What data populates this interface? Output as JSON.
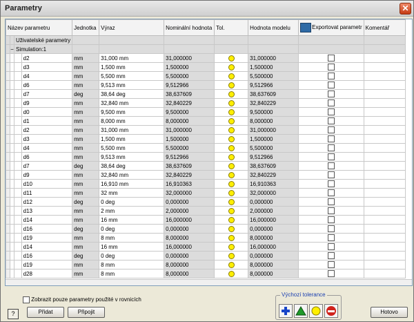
{
  "window": {
    "title": "Parametry"
  },
  "columns": [
    "Název parametru",
    "Jednotka",
    "Výraz",
    "Nominální hodnota",
    "Tol.",
    "Hodnota modelu",
    "Exportovat parametr",
    "Komentář"
  ],
  "groups": {
    "user": "Uživatelské parametry",
    "sim": "Simulation:1",
    "sim_toggle": "−"
  },
  "rows": [
    {
      "name": "d2",
      "unit": "mm",
      "expr": "31,000 mm",
      "nominal": "31,000000",
      "model": "31,000000"
    },
    {
      "name": "d3",
      "unit": "mm",
      "expr": "1,500 mm",
      "nominal": "1,500000",
      "model": "1,500000"
    },
    {
      "name": "d4",
      "unit": "mm",
      "expr": "5,500 mm",
      "nominal": "5,500000",
      "model": "5,500000"
    },
    {
      "name": "d6",
      "unit": "mm",
      "expr": "9,513 mm",
      "nominal": "9,512966",
      "model": "9,512966"
    },
    {
      "name": "d7",
      "unit": "deg",
      "expr": "38,64 deg",
      "nominal": "38,637609",
      "model": "38,637609"
    },
    {
      "name": "d9",
      "unit": "mm",
      "expr": "32,840 mm",
      "nominal": "32,840229",
      "model": "32,840229"
    },
    {
      "name": "d0",
      "unit": "mm",
      "expr": "9,500 mm",
      "nominal": "9,500000",
      "model": "9,500000"
    },
    {
      "name": "d1",
      "unit": "mm",
      "expr": "8,000 mm",
      "nominal": "8,000000",
      "model": "8,000000"
    },
    {
      "name": "d2",
      "unit": "mm",
      "expr": "31,000 mm",
      "nominal": "31,000000",
      "model": "31,000000"
    },
    {
      "name": "d3",
      "unit": "mm",
      "expr": "1,500 mm",
      "nominal": "1,500000",
      "model": "1,500000"
    },
    {
      "name": "d4",
      "unit": "mm",
      "expr": "5,500 mm",
      "nominal": "5,500000",
      "model": "5,500000"
    },
    {
      "name": "d6",
      "unit": "mm",
      "expr": "9,513 mm",
      "nominal": "9,512966",
      "model": "9,512966"
    },
    {
      "name": "d7",
      "unit": "deg",
      "expr": "38,64 deg",
      "nominal": "38,637609",
      "model": "38,637609"
    },
    {
      "name": "d9",
      "unit": "mm",
      "expr": "32,840 mm",
      "nominal": "32,840229",
      "model": "32,840229"
    },
    {
      "name": "d10",
      "unit": "mm",
      "expr": "16,910 mm",
      "nominal": "16,910363",
      "model": "16,910363"
    },
    {
      "name": "d11",
      "unit": "mm",
      "expr": "32 mm",
      "nominal": "32,000000",
      "model": "32,000000"
    },
    {
      "name": "d12",
      "unit": "deg",
      "expr": "0 deg",
      "nominal": "0,000000",
      "model": "0,000000"
    },
    {
      "name": "d13",
      "unit": "mm",
      "expr": "2 mm",
      "nominal": "2,000000",
      "model": "2,000000"
    },
    {
      "name": "d14",
      "unit": "mm",
      "expr": "16 mm",
      "nominal": "16,000000",
      "model": "16,000000"
    },
    {
      "name": "d16",
      "unit": "deg",
      "expr": "0 deg",
      "nominal": "0,000000",
      "model": "0,000000"
    },
    {
      "name": "d19",
      "unit": "mm",
      "expr": "8 mm",
      "nominal": "8,000000",
      "model": "8,000000"
    },
    {
      "name": "d14",
      "unit": "mm",
      "expr": "16 mm",
      "nominal": "16,000000",
      "model": "16,000000"
    },
    {
      "name": "d16",
      "unit": "deg",
      "expr": "0 deg",
      "nominal": "0,000000",
      "model": "0,000000"
    },
    {
      "name": "d19",
      "unit": "mm",
      "expr": "8 mm",
      "nominal": "8,000000",
      "model": "8,000000"
    },
    {
      "name": "d28",
      "unit": "mm",
      "expr": "8 mm",
      "nominal": "8,000000",
      "model": "8,000000"
    }
  ],
  "footer": {
    "filter_label": "Zobrazit pouze parametry použité v rovnicích",
    "help": "?",
    "add": "Přidat",
    "link": "Připojit",
    "tolerance_legend": "Výchozí tolerance",
    "done": "Hotovo"
  },
  "colors": {
    "tol_yellow": "#ffef00",
    "tol_green": "#1f9a2a",
    "tol_blue": "#1845c8",
    "tol_red": "#d0231b"
  }
}
